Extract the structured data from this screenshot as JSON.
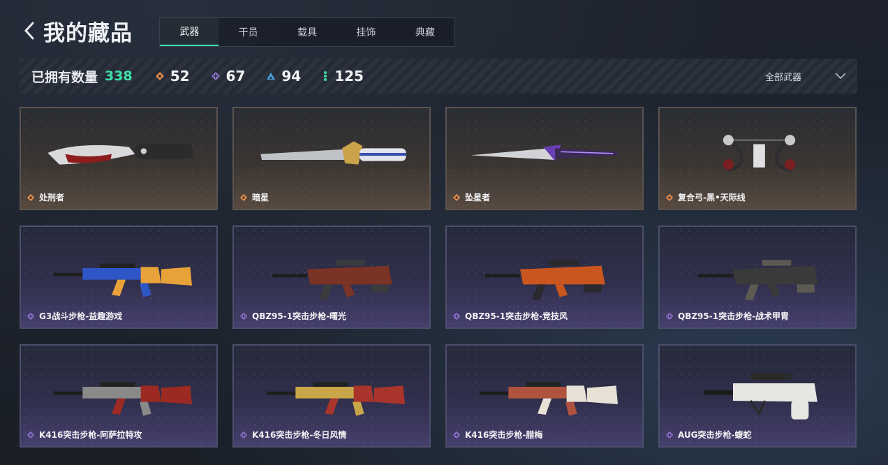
{
  "header": {
    "title": "我的藏品"
  },
  "tabs": [
    {
      "label": "武器",
      "active": true
    },
    {
      "label": "干员",
      "active": false
    },
    {
      "label": "载具",
      "active": false
    },
    {
      "label": "挂饰",
      "active": false
    },
    {
      "label": "典藏",
      "active": false
    }
  ],
  "stats": {
    "owned_label": "已拥有数量",
    "owned_count": "338",
    "tiers": [
      {
        "icon": "orange-diamond-icon",
        "color": "#e08a4a",
        "count": "52"
      },
      {
        "icon": "purple-diamond-icon",
        "color": "#9b7be0",
        "count": "67"
      },
      {
        "icon": "blue-triangle-icon",
        "color": "#4aa3e0",
        "count": "94"
      },
      {
        "icon": "green-dots-icon",
        "color": "#3fe0a8",
        "count": "125"
      }
    ],
    "filter": {
      "label": "全部武器"
    }
  },
  "items": [
    {
      "name": "处刑者",
      "rarity": "gold",
      "kind": "knife"
    },
    {
      "name": "暗星",
      "rarity": "gold",
      "kind": "blade"
    },
    {
      "name": "坠星者",
      "rarity": "gold",
      "kind": "dagger"
    },
    {
      "name": "复合弓-黑•天际线",
      "rarity": "gold",
      "kind": "bow"
    },
    {
      "name": "G3战斗步枪-益趣游戏",
      "rarity": "purple",
      "kind": "rifle",
      "c1": "#e8a23a",
      "c2": "#2f56c6"
    },
    {
      "name": "QBZ95-1突击步枪-曙光",
      "rarity": "purple",
      "kind": "bullpup",
      "c1": "#7a3325",
      "c2": "#3b3b3f"
    },
    {
      "name": "QBZ95-1突击步枪-竞技风",
      "rarity": "purple",
      "kind": "bullpup",
      "c1": "#c9561e",
      "c2": "#2a2a2e"
    },
    {
      "name": "QBZ95-1突击步枪-战术甲胄",
      "rarity": "purple",
      "kind": "bullpup",
      "c1": "#3a3a3a",
      "c2": "#5c5a52"
    },
    {
      "name": "K416突击步枪-阿萨拉特攻",
      "rarity": "purple",
      "kind": "rifle",
      "c1": "#9c2a22",
      "c2": "#8a8a8a"
    },
    {
      "name": "K416突击步枪-冬日风情",
      "rarity": "purple",
      "kind": "rifle",
      "c1": "#a8342c",
      "c2": "#caa64a"
    },
    {
      "name": "K416突击步枪-腊梅",
      "rarity": "purple",
      "kind": "rifle",
      "c1": "#e7e1d6",
      "c2": "#b0533e"
    },
    {
      "name": "AUG突击步枪-蝮蛇",
      "rarity": "purple",
      "kind": "aug",
      "c1": "#e8e6e3",
      "c2": "#2a2a2a"
    }
  ]
}
